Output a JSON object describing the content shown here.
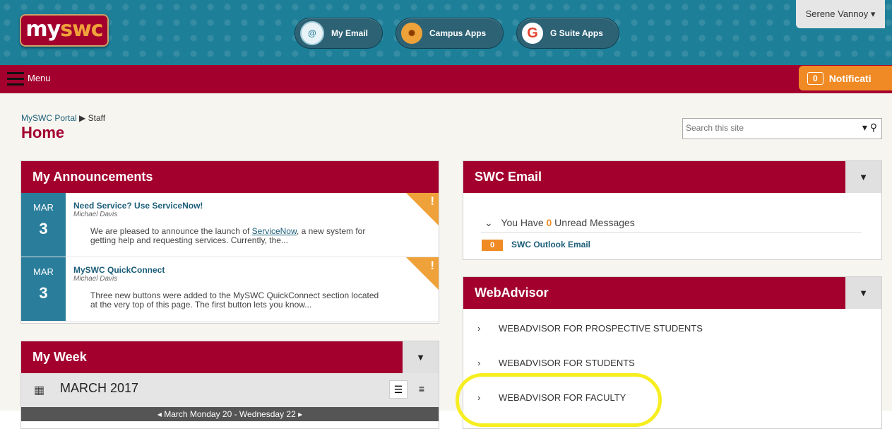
{
  "header": {
    "logo": {
      "prefix": "my",
      "suffix": "swc"
    },
    "quick_buttons": [
      {
        "label": "My Email",
        "icon": "at-sign-icon"
      },
      {
        "label": "Campus Apps",
        "icon": "sunburst-icon"
      },
      {
        "label": "G Suite Apps",
        "icon": "google-g-icon"
      }
    ],
    "user_menu": "Serene Vannoy ▾"
  },
  "menubar": {
    "menu_label": "Menu",
    "notifications": {
      "count": "0",
      "label": "Notificati"
    }
  },
  "page": {
    "breadcrumb": {
      "root": "MySWC Portal",
      "current": "Staff"
    },
    "title": "Home",
    "search": {
      "placeholder": "Search this site"
    }
  },
  "announcements": {
    "title": "My Announcements",
    "items": [
      {
        "month": "MAR",
        "day": "3",
        "title": "Need Service? Use ServiceNow!",
        "author": "Michael Davis",
        "body_pre": "We are pleased to announce the launch of ",
        "body_link": "ServiceNow",
        "body_post": ", a new system for getting help and requesting services. Currently, the..."
      },
      {
        "month": "MAR",
        "day": "3",
        "title": "MySWC QuickConnect",
        "author": "Michael Davis",
        "body": "Three new buttons were added to the MySWC QuickConnect section located at the very top of this page. The first button lets you know..."
      }
    ]
  },
  "week": {
    "title": "My Week",
    "month": "MARCH 2017",
    "range": "◂   March Monday 20 - Wednesday 22   ▸"
  },
  "email": {
    "title": "SWC Email",
    "unread_pre": "You Have ",
    "unread_count": "0",
    "unread_post": " Unread Messages",
    "outlook_badge": "0",
    "outlook_link": "SWC Outlook Email"
  },
  "webadvisor": {
    "title": "WebAdvisor",
    "items": [
      "WEBADVISOR FOR PROSPECTIVE STUDENTS",
      "WEBADVISOR FOR STUDENTS",
      "WEBADVISOR FOR FACULTY"
    ]
  },
  "colors": {
    "brand_red": "#a3002e",
    "teal": "#2a7d9b",
    "orange": "#f08a24",
    "highlight": "#f6ee20"
  }
}
